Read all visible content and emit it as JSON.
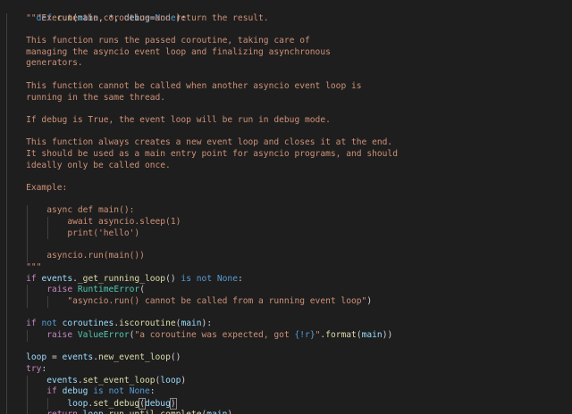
{
  "editor": {
    "language": "python",
    "theme_colors": {
      "background": "#1e1e1e",
      "keyword": "#569cd6",
      "control": "#c586c0",
      "function": "#dcdcaa",
      "variable": "#9cdcfe",
      "string": "#ce9178",
      "class": "#4ec9b0",
      "text": "#d4d4d4"
    },
    "code": {
      "def": "def",
      "run": "run",
      "main": "main",
      "debug": "debug",
      "none": "None",
      "doc_lines": [
        "\"\"\"Execute the coroutine and return the result.",
        "",
        "This function runs the passed coroutine, taking care of",
        "managing the asyncio event loop and finalizing asynchronous",
        "generators.",
        "",
        "This function cannot be called when another asyncio event loop is",
        "running in the same thread.",
        "",
        "If debug is True, the event loop will be run in debug mode.",
        "",
        "This function always creates a new event loop and closes it at the end.",
        "It should be used as a main entry point for asyncio programs, and should",
        "ideally only be called once.",
        "",
        "Example:",
        "",
        "    async def main():",
        "        await asyncio.sleep(1)",
        "        print('hello')",
        "",
        "    asyncio.run(main())",
        "\"\"\""
      ],
      "if": "if",
      "events": "events",
      "get_running_loop": "_get_running_loop",
      "is": "is",
      "not": "not",
      "raise": "raise",
      "runtime_error": "RuntimeError",
      "runtime_msg": "\"asyncio.run() cannot be called from a running event loop\"",
      "coroutines": "coroutines",
      "iscoroutine": "iscoroutine",
      "value_error": "ValueError",
      "value_msg_a": "\"a coroutine was expected, got ",
      "value_msg_fmt": "{!r}",
      "value_msg_b": "\"",
      "format": "format",
      "loop": "loop",
      "new_event_loop": "new_event_loop",
      "try": "try",
      "set_event_loop": "set_event_loop",
      "set_debug": "set_debug",
      "return": "return",
      "run_until_complete": "run_until_complete"
    }
  }
}
